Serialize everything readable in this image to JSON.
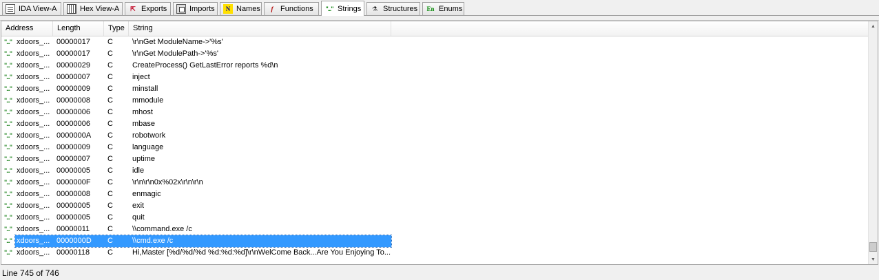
{
  "tabs": [
    {
      "label": "IDA View-A",
      "icon": "document-icon"
    },
    {
      "label": "Hex View-A",
      "icon": "hex-icon"
    },
    {
      "label": "Exports",
      "icon": "exports-icon"
    },
    {
      "label": "Imports",
      "icon": "imports-icon"
    },
    {
      "label": "Names",
      "icon": "names-icon",
      "glyph": "N"
    },
    {
      "label": "Functions",
      "icon": "functions-icon",
      "glyph": "f"
    },
    {
      "label": "Strings",
      "icon": "strings-icon",
      "glyph": "\"...\"",
      "active": true
    },
    {
      "label": "Structures",
      "icon": "structures-icon",
      "glyph": "⚗"
    },
    {
      "label": "Enums",
      "icon": "enums-icon",
      "glyph": "En"
    }
  ],
  "table": {
    "columns": [
      "Address",
      "Length",
      "Type",
      "String"
    ],
    "row_icon": "\"...\"",
    "rows": [
      {
        "address": "xdoors_...",
        "length": "00000017",
        "type": "C",
        "string": "\\r\\nGet ModuleName->'%s'"
      },
      {
        "address": "xdoors_...",
        "length": "00000017",
        "type": "C",
        "string": "\\r\\nGet ModulePath->'%s'"
      },
      {
        "address": "xdoors_...",
        "length": "00000029",
        "type": "C",
        "string": "CreateProcess() GetLastError reports %d\\n"
      },
      {
        "address": "xdoors_...",
        "length": "00000007",
        "type": "C",
        "string": "inject"
      },
      {
        "address": "xdoors_...",
        "length": "00000009",
        "type": "C",
        "string": "minstall"
      },
      {
        "address": "xdoors_...",
        "length": "00000008",
        "type": "C",
        "string": "mmodule"
      },
      {
        "address": "xdoors_...",
        "length": "00000006",
        "type": "C",
        "string": "mhost"
      },
      {
        "address": "xdoors_...",
        "length": "00000006",
        "type": "C",
        "string": "mbase"
      },
      {
        "address": "xdoors_...",
        "length": "0000000A",
        "type": "C",
        "string": "robotwork"
      },
      {
        "address": "xdoors_...",
        "length": "00000009",
        "type": "C",
        "string": "language"
      },
      {
        "address": "xdoors_...",
        "length": "00000007",
        "type": "C",
        "string": "uptime"
      },
      {
        "address": "xdoors_...",
        "length": "00000005",
        "type": "C",
        "string": "idle"
      },
      {
        "address": "xdoors_...",
        "length": "0000000F",
        "type": "C",
        "string": "\\r\\n\\r\\n0x%02x\\r\\n\\r\\n"
      },
      {
        "address": "xdoors_...",
        "length": "00000008",
        "type": "C",
        "string": "enmagic"
      },
      {
        "address": "xdoors_...",
        "length": "00000005",
        "type": "C",
        "string": "exit"
      },
      {
        "address": "xdoors_...",
        "length": "00000005",
        "type": "C",
        "string": "quit"
      },
      {
        "address": "xdoors_...",
        "length": "00000011",
        "type": "C",
        "string": "\\\\command.exe /c"
      },
      {
        "address": "xdoors_...",
        "length": "0000000D",
        "type": "C",
        "string": "\\\\cmd.exe /c",
        "selected": true
      },
      {
        "address": "xdoors_...",
        "length": "00000118",
        "type": "C",
        "string": "Hi,Master [%d/%d/%d %d:%d:%d]\\r\\nWelCome Back...Are You Enjoying To..."
      }
    ]
  },
  "status": {
    "text": "Line 745 of 746"
  },
  "colors": {
    "selection": "#3399ff",
    "string_icon": "#2a8a2a"
  }
}
